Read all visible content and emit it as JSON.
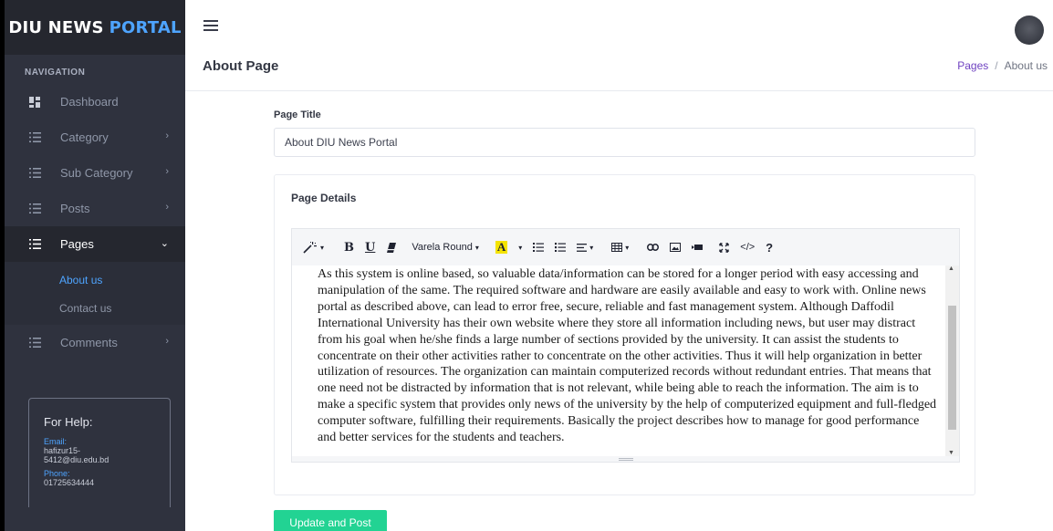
{
  "brand": {
    "part1": "DIU NEWS",
    "part2": "PORTAL"
  },
  "sidebar": {
    "section_title": "NAVIGATION",
    "items": [
      {
        "label": "Dashboard",
        "icon": "dashboard-icon"
      },
      {
        "label": "Category",
        "icon": "list-icon"
      },
      {
        "label": "Sub Category",
        "icon": "list-icon"
      },
      {
        "label": "Posts",
        "icon": "list-icon"
      },
      {
        "label": "Pages",
        "icon": "list-icon"
      },
      {
        "label": "Comments",
        "icon": "list-icon"
      }
    ],
    "pages_subitems": [
      "About us",
      "Contact us"
    ]
  },
  "help": {
    "title": "For Help:",
    "email_label": "Email:",
    "email_line1": "hafizur15-",
    "email_line2": "5412@diu.edu.bd",
    "phone_label": "Phone:",
    "phone": "01725634444"
  },
  "header": {
    "page_title": "About Page",
    "breadcrumb": [
      "Pages",
      "About us"
    ]
  },
  "form": {
    "title_label": "Page Title",
    "title_value": "About DIU News Portal",
    "details_label": "Page Details",
    "font_name": "Varela Round",
    "details_text": "As this system is online based, so valuable data/information can be stored for a longer period with easy accessing and manipulation of the same. The required software and hardware are easily available and easy to work with. Online news portal as described above, can lead to error free, secure, reliable and fast management system. Although Daffodil International University has their own website where they store all information including news, but user may distract from his goal when he/she finds a large number of sections provided by the university. It can assist the students to concentrate on their other activities rather to concentrate on the other activities. Thus it will help organization in better utilization of resources. The organization can maintain computerized records without redundant entries. That means that one need not be distracted by information that is not relevant, while being able to reach the information. The aim is to make a specific system that provides only news of the university by the help of computerized equipment and full-fledged computer software, fulfilling their requirements. Basically the project describes how to manage for good performance and better services for the students and teachers.",
    "submit_label": "Update and Post"
  },
  "toolbar": {
    "bold": "B",
    "underline": "U",
    "highlight": "A",
    "help": "?",
    "code": "</>"
  },
  "colors": {
    "sidebar_bg": "#2f323e",
    "brand_accent": "#4ea4ff",
    "breadcrumb_link": "#6f42c1",
    "submit_bg": "#22d393"
  }
}
